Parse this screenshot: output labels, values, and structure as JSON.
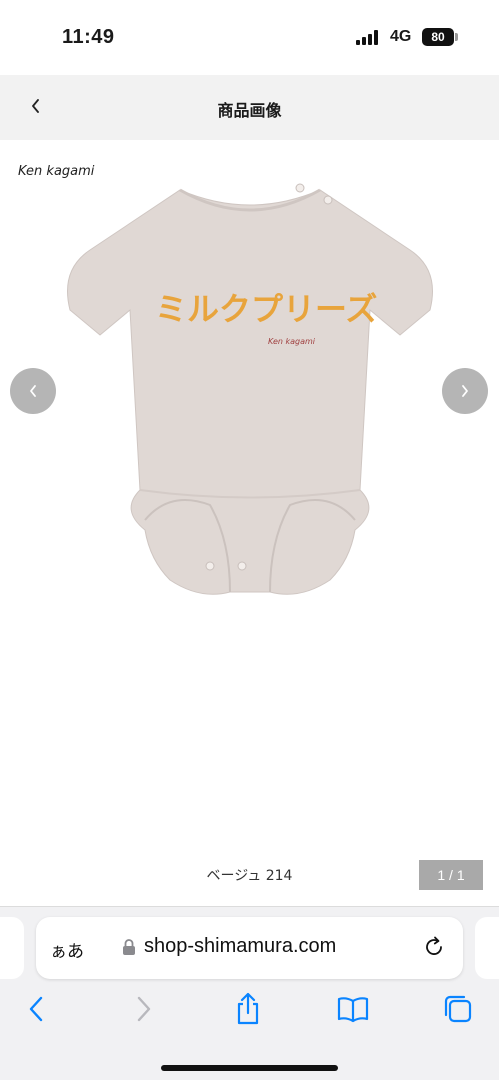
{
  "status_bar": {
    "time": "11:49",
    "network": "4G",
    "battery": "80"
  },
  "header": {
    "back_icon": "chevron-left-icon",
    "title": "商品画像"
  },
  "product": {
    "brand_logo_text": "Ken kagami",
    "print_text": "ミルクプリーズ",
    "print_color": "#e8a43c",
    "garment_color": "#e0d8d4",
    "prev_icon": "chevron-left-icon",
    "next_icon": "chevron-right-icon"
  },
  "caption": {
    "color_size": "ベージュ 214",
    "counter": "1 / 1"
  },
  "browser": {
    "reader_label": "ぁあ",
    "url": "shop-shimamura.com",
    "accent": "#0a84ff",
    "toolbar": [
      "back-icon",
      "forward-icon",
      "share-icon",
      "bookmarks-icon",
      "tabs-icon"
    ]
  }
}
